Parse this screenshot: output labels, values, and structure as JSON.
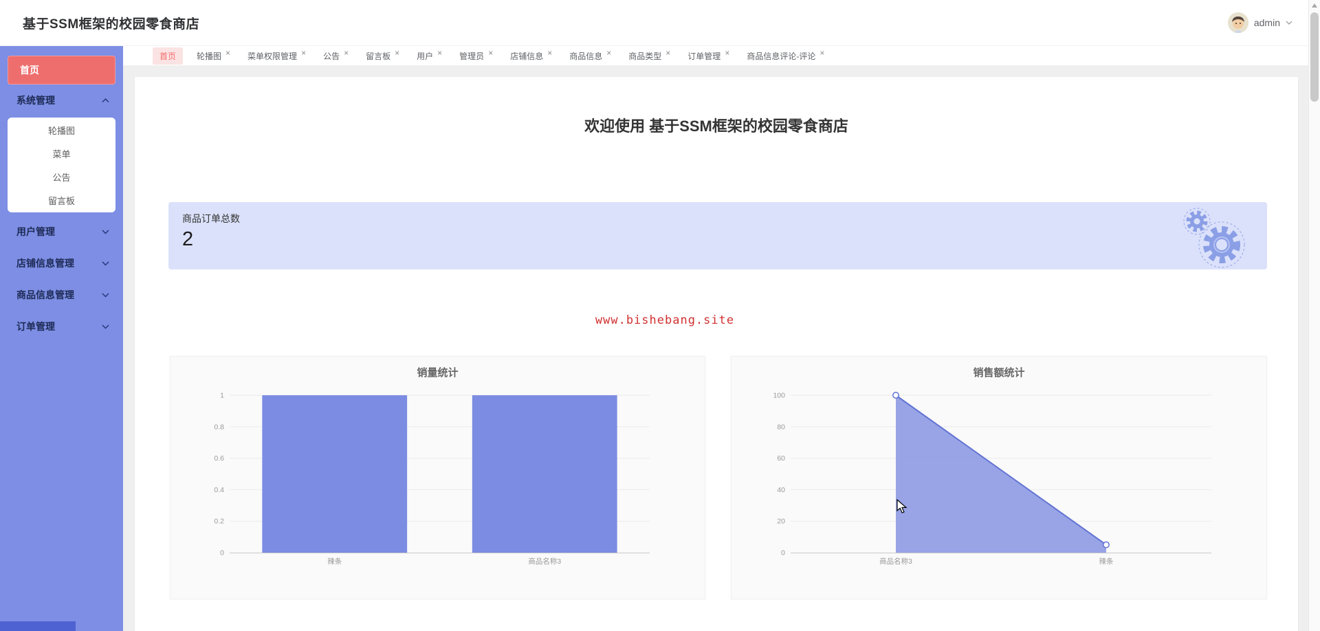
{
  "header": {
    "title": "基于SSM框架的校园零食商店",
    "user": {
      "name": "admin"
    }
  },
  "sidebar": {
    "items": [
      {
        "label": "首页",
        "type": "home",
        "active": true
      },
      {
        "label": "系统管理",
        "type": "group",
        "expanded": true,
        "children": [
          "轮播图",
          "菜单",
          "公告",
          "留言板"
        ]
      },
      {
        "label": "用户管理",
        "type": "group",
        "expanded": false
      },
      {
        "label": "店铺信息管理",
        "type": "group",
        "expanded": false
      },
      {
        "label": "商品信息管理",
        "type": "group",
        "expanded": false
      },
      {
        "label": "订单管理",
        "type": "group",
        "expanded": false
      }
    ]
  },
  "tabs": [
    {
      "label": "首页",
      "active": true,
      "closable": false
    },
    {
      "label": "轮播图",
      "active": false,
      "closable": true
    },
    {
      "label": "菜单权限管理",
      "active": false,
      "closable": true
    },
    {
      "label": "公告",
      "active": false,
      "closable": true
    },
    {
      "label": "留言板",
      "active": false,
      "closable": true
    },
    {
      "label": "用户",
      "active": false,
      "closable": true
    },
    {
      "label": "管理员",
      "active": false,
      "closable": true
    },
    {
      "label": "店铺信息",
      "active": false,
      "closable": true
    },
    {
      "label": "商品信息",
      "active": false,
      "closable": true
    },
    {
      "label": "商品类型",
      "active": false,
      "closable": true
    },
    {
      "label": "订单管理",
      "active": false,
      "closable": true
    },
    {
      "label": "商品信息评论-评论",
      "active": false,
      "closable": true
    }
  ],
  "icons": {
    "close": "×"
  },
  "main": {
    "welcome_title": "欢迎使用 基于SSM框架的校园零食商店",
    "stat_card": {
      "label": "商品订单总数",
      "value": "2",
      "decoration": "gears-icon"
    },
    "site_link": "www.bishebang.site"
  },
  "chart_data": [
    {
      "type": "bar",
      "title": "销量统计",
      "categories": [
        "辣条",
        "商品名称3"
      ],
      "values": [
        1,
        1
      ],
      "yticks": [
        0,
        0.2,
        0.4,
        0.6,
        0.8,
        1
      ],
      "ylim": [
        0,
        1
      ],
      "xlabel": "",
      "ylabel": "",
      "grid": true,
      "legend": false,
      "bar_color": "#7b8ce2"
    },
    {
      "type": "area",
      "title": "销售额统计",
      "categories": [
        "商品名称3",
        "辣条"
      ],
      "values": [
        100,
        5
      ],
      "yticks": [
        0,
        20,
        40,
        60,
        80,
        100
      ],
      "ylim": [
        0,
        100
      ],
      "xlabel": "",
      "ylabel": "",
      "grid": true,
      "legend": false,
      "line_color": "#6273d3",
      "area_color": "rgba(124,140,224,0.78)",
      "marker": "hollow-circle"
    }
  ],
  "theme": {
    "sidebar_bg": "#7d8ee4",
    "sidebar_active_bg": "#ee6e6e",
    "tab_active_bg": "#fbe3e3",
    "tab_active_text": "#f56c6c",
    "stat_card_bg": "#dbe1fa",
    "link_red": "#d03030",
    "chart_purple": "#7b8ce2"
  }
}
